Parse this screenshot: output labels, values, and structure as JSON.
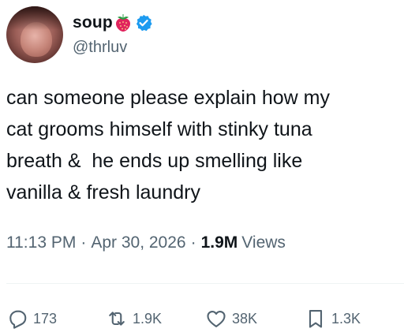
{
  "author": {
    "display_name": "soup",
    "name_emoji": "strawberry-icon",
    "verified_badge": "verified-icon",
    "handle": "@thrluv"
  },
  "tweet": {
    "text": "can someone please explain how my\ncat grooms himself with stinky tuna\nbreath &  he ends up smelling like\nvanilla & fresh laundry"
  },
  "meta": {
    "time": "11:13 PM",
    "separator": "·",
    "date": "Apr 30, 2026",
    "views_count": "1.9M",
    "views_label": "Views"
  },
  "actions": {
    "replies": "173",
    "reposts": "1.9K",
    "likes": "38K",
    "bookmarks": "1.3K"
  },
  "colors": {
    "text": "#0f1419",
    "secondary": "#536471",
    "verified": "#1d9bf0",
    "divider": "#eff3f4"
  }
}
